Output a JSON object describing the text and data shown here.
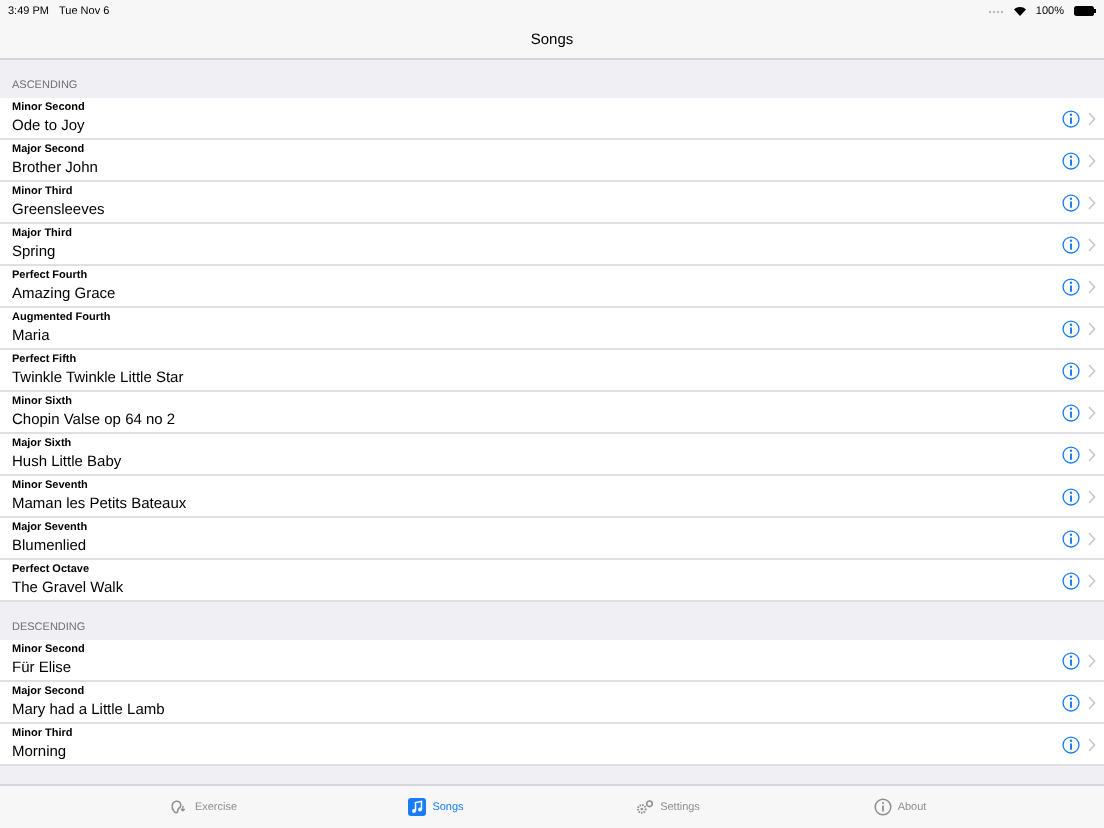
{
  "status_bar": {
    "time": "3:49 PM",
    "date": "Tue Nov 6",
    "battery": "100%"
  },
  "nav": {
    "title": "Songs"
  },
  "sections": [
    {
      "header": "ASCENDING",
      "rows": [
        {
          "interval": "Minor Second",
          "song": "Ode to Joy"
        },
        {
          "interval": "Major Second",
          "song": "Brother John"
        },
        {
          "interval": "Minor Third",
          "song": "Greensleeves"
        },
        {
          "interval": "Major Third",
          "song": "Spring"
        },
        {
          "interval": "Perfect Fourth",
          "song": "Amazing Grace"
        },
        {
          "interval": "Augmented Fourth",
          "song": "Maria"
        },
        {
          "interval": "Perfect Fifth",
          "song": "Twinkle Twinkle Little Star"
        },
        {
          "interval": "Minor Sixth",
          "song": "Chopin Valse op 64 no 2"
        },
        {
          "interval": "Major Sixth",
          "song": "Hush Little Baby"
        },
        {
          "interval": "Minor Seventh",
          "song": "Maman les Petits Bateaux"
        },
        {
          "interval": "Major Seventh",
          "song": "Blumenlied"
        },
        {
          "interval": "Perfect Octave",
          "song": "The Gravel Walk"
        }
      ]
    },
    {
      "header": "DESCENDING",
      "rows": [
        {
          "interval": "Minor Second",
          "song": "Für Elise"
        },
        {
          "interval": "Major Second",
          "song": "Mary had a Little Lamb"
        },
        {
          "interval": "Minor Third",
          "song": "Morning"
        }
      ]
    }
  ],
  "tabs": [
    {
      "kind": "ear",
      "label": "Exercise",
      "selected": false
    },
    {
      "kind": "note",
      "label": "Songs",
      "selected": true
    },
    {
      "kind": "gears",
      "label": "Settings",
      "selected": false
    },
    {
      "kind": "info",
      "label": "About",
      "selected": false
    }
  ]
}
